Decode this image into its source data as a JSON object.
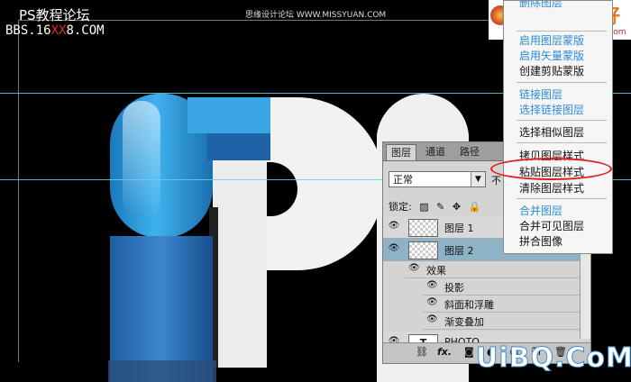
{
  "header": {
    "site_title": "PS教程论坛",
    "url_prefix": "BBS.16",
    "url_highlight": "XX",
    "url_suffix": "8.COM",
    "center_caption": "思缘设计论坛 WWW.MISSYUAN.COM"
  },
  "watermark": {
    "top_right": "爱好者",
    "top_right_url": "www.psahz.com",
    "bottom_right": "UiBQ.CoM"
  },
  "layers_panel": {
    "tabs": [
      "图层",
      "通道",
      "路径"
    ],
    "blend_mode": "正常",
    "opacity_label": "不",
    "lock_label": "锁定:",
    "layers": [
      {
        "name": "图层 1",
        "selected": false
      },
      {
        "name": "图层 2",
        "selected": true
      }
    ],
    "effects_label": "效果",
    "effects": [
      "投影",
      "斜面和浮雕",
      "渐变叠加"
    ],
    "text_layer_name": "PHOTO",
    "text_layer_thumb": "T",
    "footer_fx": "fx."
  },
  "context_menu": {
    "top_partial": "删除图层",
    "groups": [
      [
        {
          "label": "启用图层蒙版",
          "enabled": false
        },
        {
          "label": "启用矢量蒙版",
          "enabled": false
        },
        {
          "label": "创建剪贴蒙版",
          "enabled": true
        }
      ],
      [
        {
          "label": "链接图层",
          "enabled": false
        },
        {
          "label": "选择链接图层",
          "enabled": false
        }
      ],
      [
        {
          "label": "选择相似图层",
          "enabled": true
        }
      ],
      [
        {
          "label": "拷贝图层样式",
          "enabled": true
        },
        {
          "label": "粘贴图层样式",
          "enabled": true
        },
        {
          "label": "清除图层样式",
          "enabled": true
        }
      ],
      [
        {
          "label": "合并图层",
          "enabled": false
        },
        {
          "label": "合并可见图层",
          "enabled": true
        },
        {
          "label": "拼合图像",
          "enabled": true
        }
      ]
    ],
    "highlighted": "粘贴图层样式",
    "highlight_color": "#e21a1a"
  },
  "colors": {
    "accent_blue": "#2b8ad6",
    "guide": "#5fd3e8",
    "selected_layer": "#8fb3c6"
  }
}
